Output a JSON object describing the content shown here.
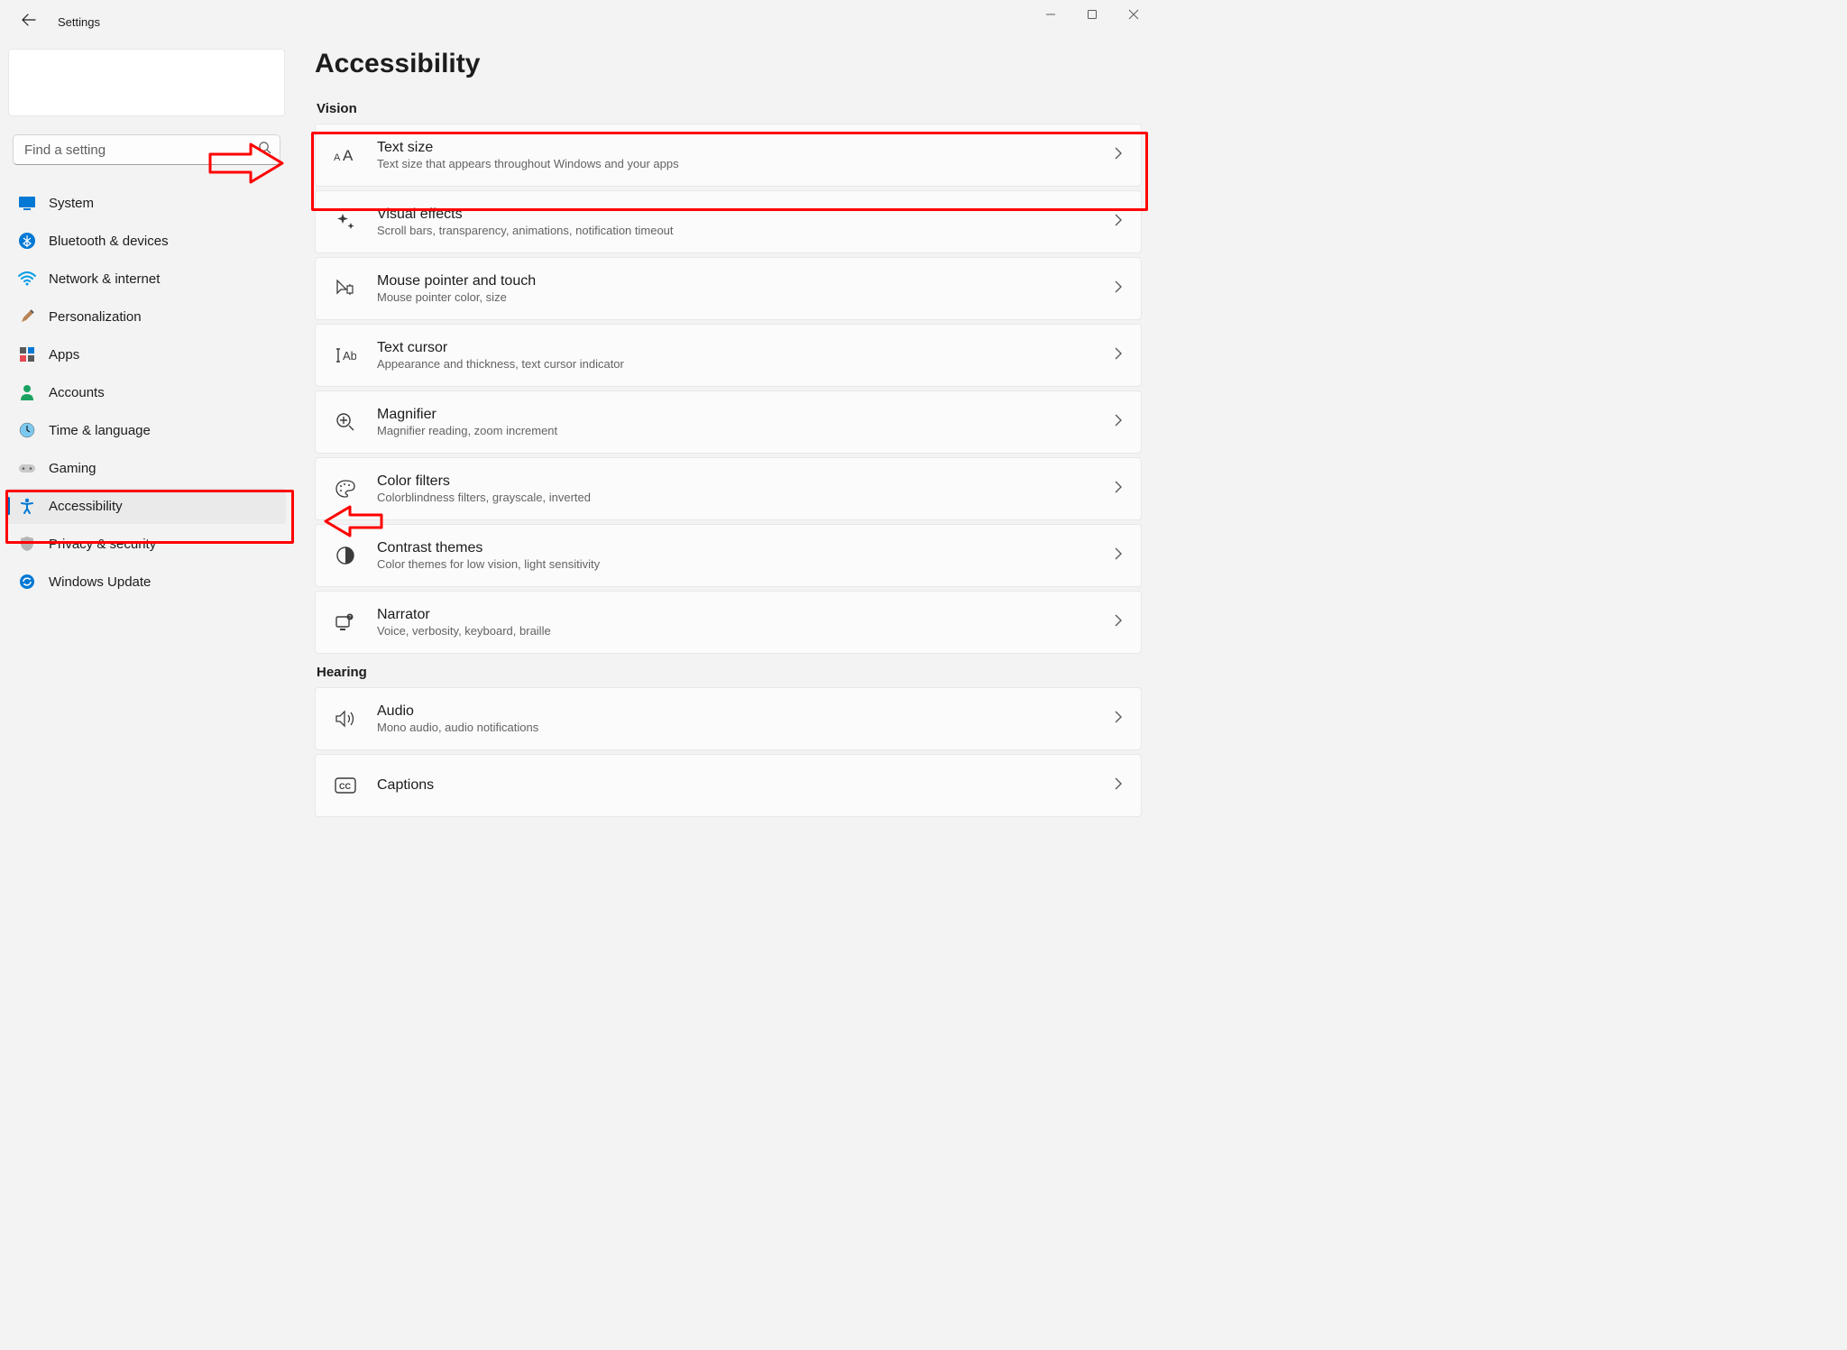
{
  "titlebar": {
    "label": "Settings"
  },
  "search": {
    "placeholder": "Find a setting"
  },
  "sidebar": {
    "items": [
      {
        "label": "System",
        "key": "system"
      },
      {
        "label": "Bluetooth & devices",
        "key": "bluetooth"
      },
      {
        "label": "Network & internet",
        "key": "network"
      },
      {
        "label": "Personalization",
        "key": "personalization"
      },
      {
        "label": "Apps",
        "key": "apps"
      },
      {
        "label": "Accounts",
        "key": "accounts"
      },
      {
        "label": "Time & language",
        "key": "time"
      },
      {
        "label": "Gaming",
        "key": "gaming"
      },
      {
        "label": "Accessibility",
        "key": "accessibility",
        "active": true
      },
      {
        "label": "Privacy & security",
        "key": "privacy"
      },
      {
        "label": "Windows Update",
        "key": "update"
      }
    ]
  },
  "page": {
    "title": "Accessibility"
  },
  "sections": [
    {
      "label": "Vision",
      "tiles": [
        {
          "key": "text-size",
          "title": "Text size",
          "sub": "Text size that appears throughout Windows and your apps"
        },
        {
          "key": "visual-effects",
          "title": "Visual effects",
          "sub": "Scroll bars, transparency, animations, notification timeout"
        },
        {
          "key": "mouse-pointer",
          "title": "Mouse pointer and touch",
          "sub": "Mouse pointer color, size"
        },
        {
          "key": "text-cursor",
          "title": "Text cursor",
          "sub": "Appearance and thickness, text cursor indicator"
        },
        {
          "key": "magnifier",
          "title": "Magnifier",
          "sub": "Magnifier reading, zoom increment"
        },
        {
          "key": "color-filters",
          "title": "Color filters",
          "sub": "Colorblindness filters, grayscale, inverted"
        },
        {
          "key": "contrast-themes",
          "title": "Contrast themes",
          "sub": "Color themes for low vision, light sensitivity"
        },
        {
          "key": "narrator",
          "title": "Narrator",
          "sub": "Voice, verbosity, keyboard, braille"
        }
      ]
    },
    {
      "label": "Hearing",
      "tiles": [
        {
          "key": "audio",
          "title": "Audio",
          "sub": "Mono audio, audio notifications"
        },
        {
          "key": "captions",
          "title": "Captions",
          "sub": ""
        }
      ]
    }
  ]
}
